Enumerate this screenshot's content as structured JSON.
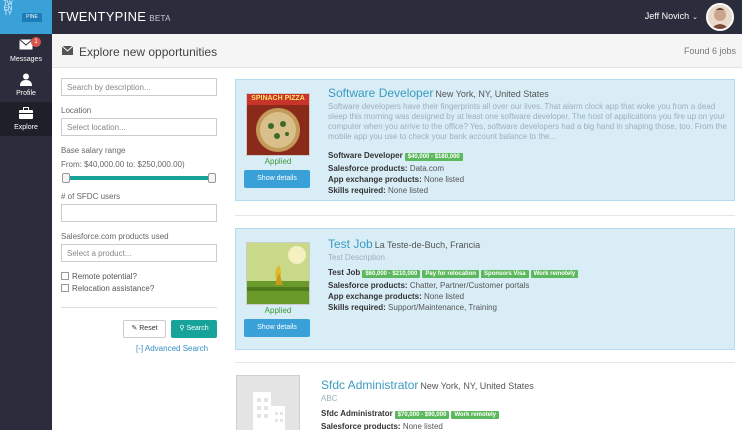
{
  "app": {
    "logo_vertical": "TWENTY",
    "logo_box": "PINE",
    "brand": "TWENTYPINE",
    "beta": "BETA",
    "user_name": "Jeff Novich"
  },
  "sidebar": {
    "items": [
      {
        "label": "Messages",
        "badge": "1",
        "icon": "envelope-icon"
      },
      {
        "label": "Profile",
        "icon": "user-icon"
      },
      {
        "label": "Explore",
        "icon": "briefcase-icon"
      }
    ]
  },
  "header": {
    "title": "Explore new opportunities",
    "found": "Found 6 jobs"
  },
  "filters": {
    "search_placeholder": "Search by description...",
    "location_label": "Location",
    "location_placeholder": "Select location...",
    "salary_label": "Base salary range",
    "salary_range_text": "From: $40,000.00 to: $250,000.00)",
    "salary_low_fraction": 0.0,
    "salary_high_fraction": 1.0,
    "users_label": "# of SFDC users",
    "products_label": "Salesforce.com products used",
    "products_placeholder": "Select a product...",
    "remote_label": "Remote potential?",
    "relocation_label": "Relocation assistance?",
    "reset_label": "Reset",
    "search_label": "Search",
    "advanced_label": "[-] Advanced Search"
  },
  "jobs": [
    {
      "title": "Software Developer",
      "location": "New York, NY, United States",
      "description": "Software developers have their fingerprints all over our lives. That alarm clock app that woke you from a dead sleep this morning was designed by at least one software developer. The host of applications you fire up on your computer when you arrive to the office? Yes, software developers had a big hand in shaping those, too. From the mobile app you use to check your bank account balance to the...",
      "status": "Applied",
      "show_label": "Show details",
      "role_label": "Software Developer",
      "tags": [
        "$40,000 - $180,000"
      ],
      "products_key": "Salesforce products:",
      "products": "Data.com",
      "appex_key": "App exchange products:",
      "appex": "None listed",
      "skills_key": "Skills required:",
      "skills": "None listed",
      "thumb_text": "SPINACH PIZZA"
    },
    {
      "title": "Test Job",
      "location": "La Teste-de-Buch, Francia",
      "description": "Test Description",
      "status": "Applied",
      "show_label": "Show details",
      "role_label": "Test Job",
      "tags": [
        "$60,000 - $210,000",
        "Pay for relocation",
        "Sponsors Visa",
        "Work remotely"
      ],
      "products_key": "Salesforce products:",
      "products": "Chatter, Partner/Customer portals",
      "appex_key": "App exchange products:",
      "appex": "None listed",
      "skills_key": "Skills required:",
      "skills": "Support/Maintenance, Training"
    },
    {
      "title": "Sfdc Administrator",
      "location": "New York, NY, United States",
      "description": "ABC",
      "role_label": "Sfdc Administrator",
      "tags": [
        "$70,000 - $90,000",
        "Work remotely"
      ],
      "products_key": "Salesforce products:",
      "products": "None listed"
    }
  ],
  "colors": {
    "accent": "#17a39a",
    "topbar": "#2b2d3c",
    "highlight": "#d9edf7",
    "tag": "#5cb85c",
    "link": "#3a9bbf"
  }
}
